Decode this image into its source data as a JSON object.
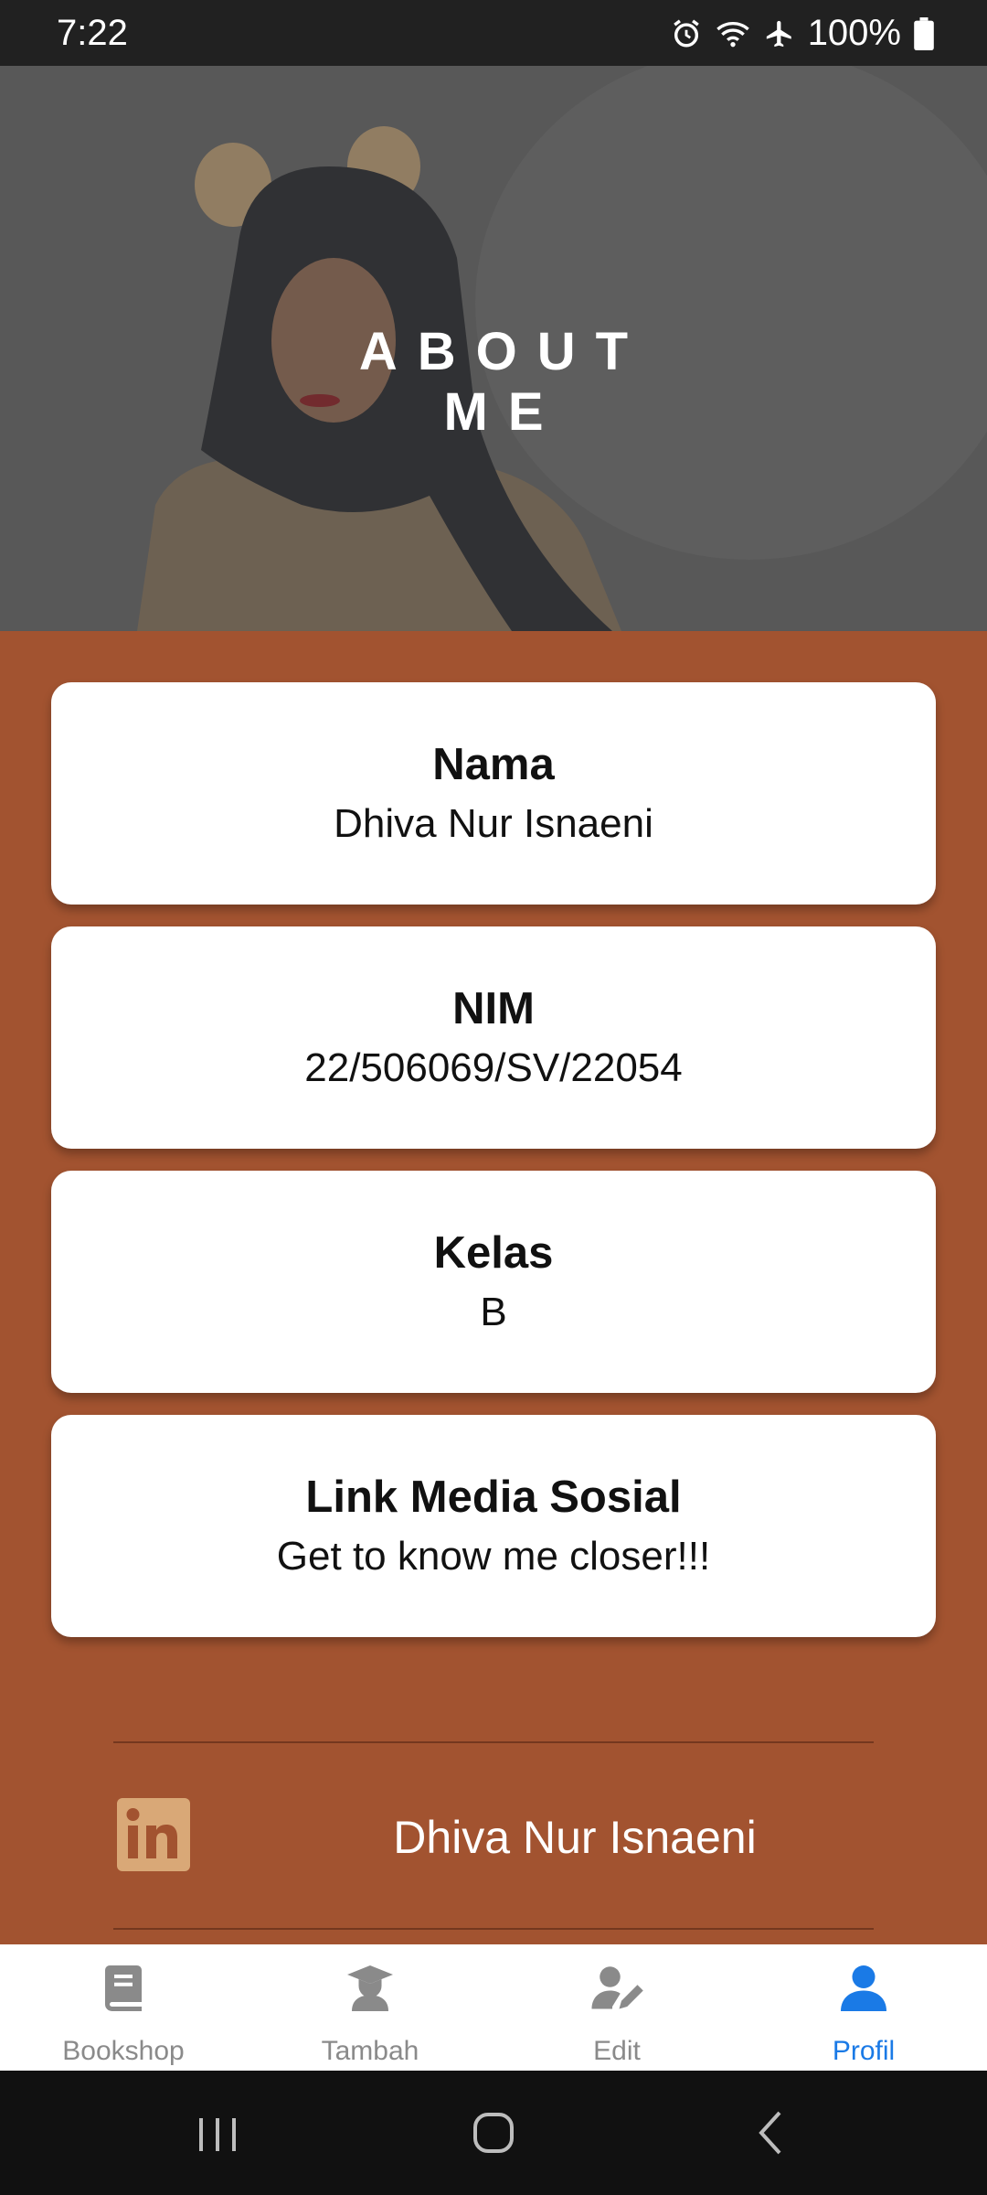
{
  "status": {
    "time": "7:22",
    "battery": "100%"
  },
  "hero": {
    "title_line1": "ABOUT",
    "title_line2": "ME"
  },
  "cards": [
    {
      "title": "Nama",
      "value": "Dhiva Nur Isnaeni"
    },
    {
      "title": "NIM",
      "value": "22/506069/SV/22054"
    },
    {
      "title": "Kelas",
      "value": "B"
    },
    {
      "title": "Link Media Sosial",
      "value": "Get to know me closer!!!"
    }
  ],
  "social": {
    "linkedin_name": "Dhiva Nur Isnaeni",
    "icon": "linkedin-icon"
  },
  "nav": {
    "items": [
      {
        "label": "Bookshop",
        "icon": "book-icon"
      },
      {
        "label": "Tambah",
        "icon": "graduate-icon"
      },
      {
        "label": "Edit",
        "icon": "user-edit-icon"
      },
      {
        "label": "Profil",
        "icon": "user-icon"
      }
    ],
    "active": "Profil"
  },
  "colors": {
    "background": "#A25330",
    "accent": "#1a7ae6"
  }
}
